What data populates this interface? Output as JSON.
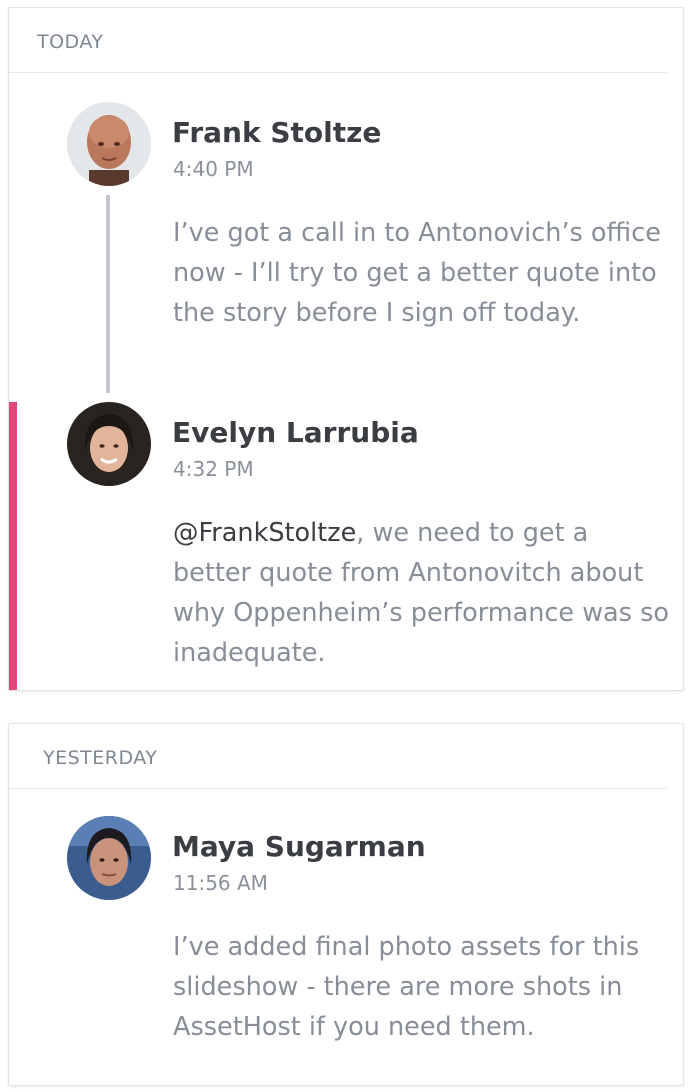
{
  "sections": [
    {
      "label": "TODAY",
      "comments": [
        {
          "author": "Frank Stoltze",
          "time": "4:40 PM",
          "avatar_icon": "user-avatar-photo",
          "body_mention": "",
          "body": "I’ve got a call in to Antonovich’s office now - I’ll try to get a better quote into the story before I sign off today."
        },
        {
          "author": "Evelyn Larrubia",
          "time": "4:32 PM",
          "avatar_icon": "user-avatar-photo",
          "highlighted": true,
          "body_mention": "@FrankStoltze",
          "body": ", we need to get a better quote from Antonovitch about why Oppenheim’s performance was so inadequate."
        }
      ]
    },
    {
      "label": "YESTERDAY",
      "comments": [
        {
          "author": "Maya Sugarman",
          "time": "11:56 AM",
          "avatar_icon": "user-avatar-photo",
          "body_mention": "",
          "body": "I’ve added final photo assets for this slideshow - there are more shots in AssetHost if you need them."
        }
      ]
    }
  ],
  "colors": {
    "accent": "#e0457b",
    "author_text": "#3a3d42",
    "body_text": "#878e98",
    "muted_text": "#8a919b",
    "thread_line": "#c3c7cd"
  }
}
